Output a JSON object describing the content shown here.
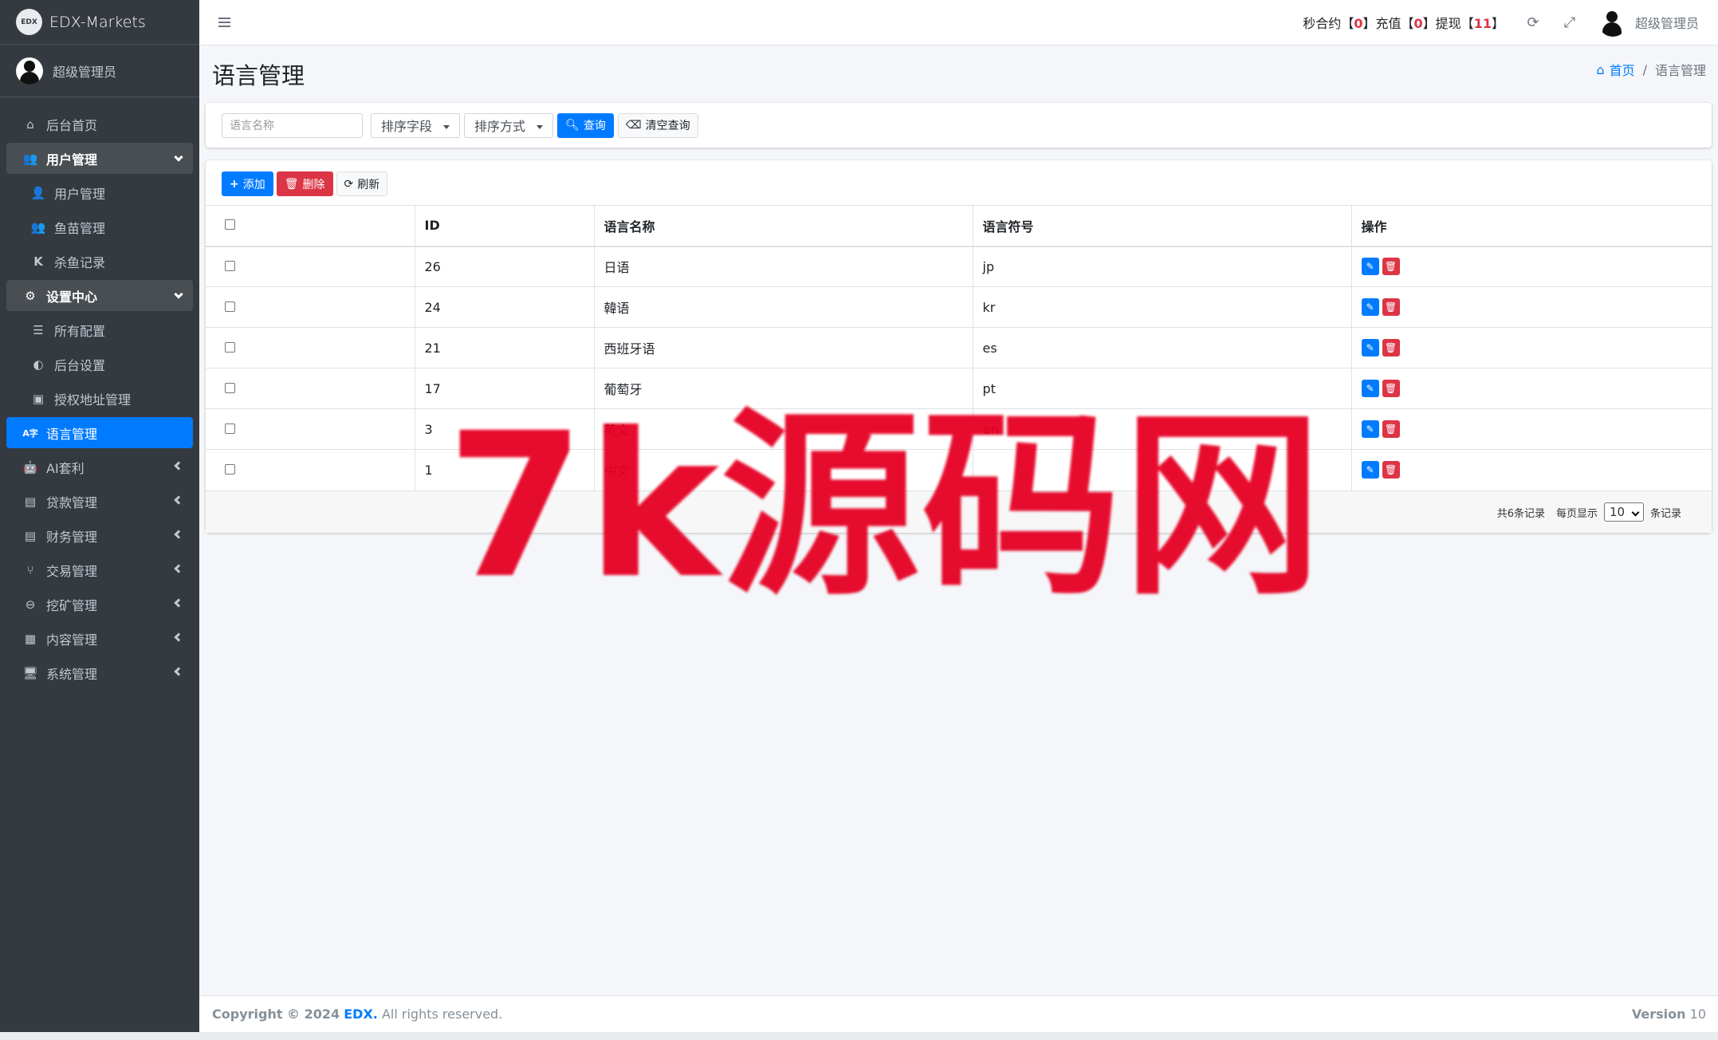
{
  "brand": {
    "logo_text": "EDX",
    "title": "EDX-Markets"
  },
  "sidebar": {
    "user": "超级管理员",
    "items": [
      {
        "label": "后台首页",
        "icon": "home-icon"
      },
      {
        "label": "用户管理",
        "icon": "users-icon",
        "state": "open"
      },
      {
        "label": "用户管理",
        "icon": "user-icon",
        "sub": true
      },
      {
        "label": "鱼苗管理",
        "icon": "users-icon",
        "sub": true
      },
      {
        "label": "杀鱼记录",
        "icon": "k-icon",
        "sub": true
      },
      {
        "label": "设置中心",
        "icon": "gears-icon",
        "state": "open"
      },
      {
        "label": "所有配置",
        "icon": "list-icon",
        "sub": true
      },
      {
        "label": "后台设置",
        "icon": "contrast-icon",
        "sub": true
      },
      {
        "label": "授权地址管理",
        "icon": "address-icon",
        "sub": true
      },
      {
        "label": "语言管理",
        "icon": "language-icon",
        "state": "active"
      },
      {
        "label": "AI套利",
        "icon": "android-icon"
      },
      {
        "label": "贷款管理",
        "icon": "money-icon"
      },
      {
        "label": "财务管理",
        "icon": "money-icon"
      },
      {
        "label": "交易管理",
        "icon": "fork-icon"
      },
      {
        "label": "挖矿管理",
        "icon": "search-minus-icon"
      },
      {
        "label": "内容管理",
        "icon": "newspaper-icon"
      },
      {
        "label": "系统管理",
        "icon": "desktop-icon"
      }
    ]
  },
  "topbar": {
    "stat1_label": "秒合约",
    "stat1_value": "0",
    "stat2_label": "充值",
    "stat2_value": "0",
    "stat3_label": "提现",
    "stat3_value": "11",
    "user": "超级管理员"
  },
  "page": {
    "title": "语言管理",
    "breadcrumb_home": "首页",
    "breadcrumb_current": "语言管理"
  },
  "search": {
    "placeholder": "语言名称",
    "sort_field": "排序字段",
    "sort_order": "排序方式",
    "search_btn": "查询",
    "clear_btn": "清空查询"
  },
  "toolbar": {
    "add": "添加",
    "delete": "删除",
    "refresh": "刷新"
  },
  "table": {
    "headers": [
      "ID",
      "语言名称",
      "语言符号",
      "操作"
    ],
    "rows": [
      {
        "id": "26",
        "name": "日语",
        "symbol": "jp"
      },
      {
        "id": "24",
        "name": "韓语",
        "symbol": "kr"
      },
      {
        "id": "21",
        "name": "西班牙语",
        "symbol": "es"
      },
      {
        "id": "17",
        "name": "葡萄牙",
        "symbol": "pt"
      },
      {
        "id": "3",
        "name": "英文",
        "symbol": "en"
      },
      {
        "id": "1",
        "name": "中文",
        "symbol": ""
      }
    ],
    "total_text": "共6条记录",
    "per_page_label": "每页显示",
    "per_page_value": "10",
    "per_page_suffix": "条记录"
  },
  "watermark": "7k源码网",
  "footer": {
    "copyright_prefix": "Copyright © 2024",
    "brand": "EDX.",
    "rights": "All rights reserved.",
    "version_label": "Version",
    "version_value": "10"
  },
  "colors": {
    "primary": "#007bff",
    "danger": "#dc3545",
    "sidebar_bg": "#343a40",
    "watermark": "#e60023"
  }
}
